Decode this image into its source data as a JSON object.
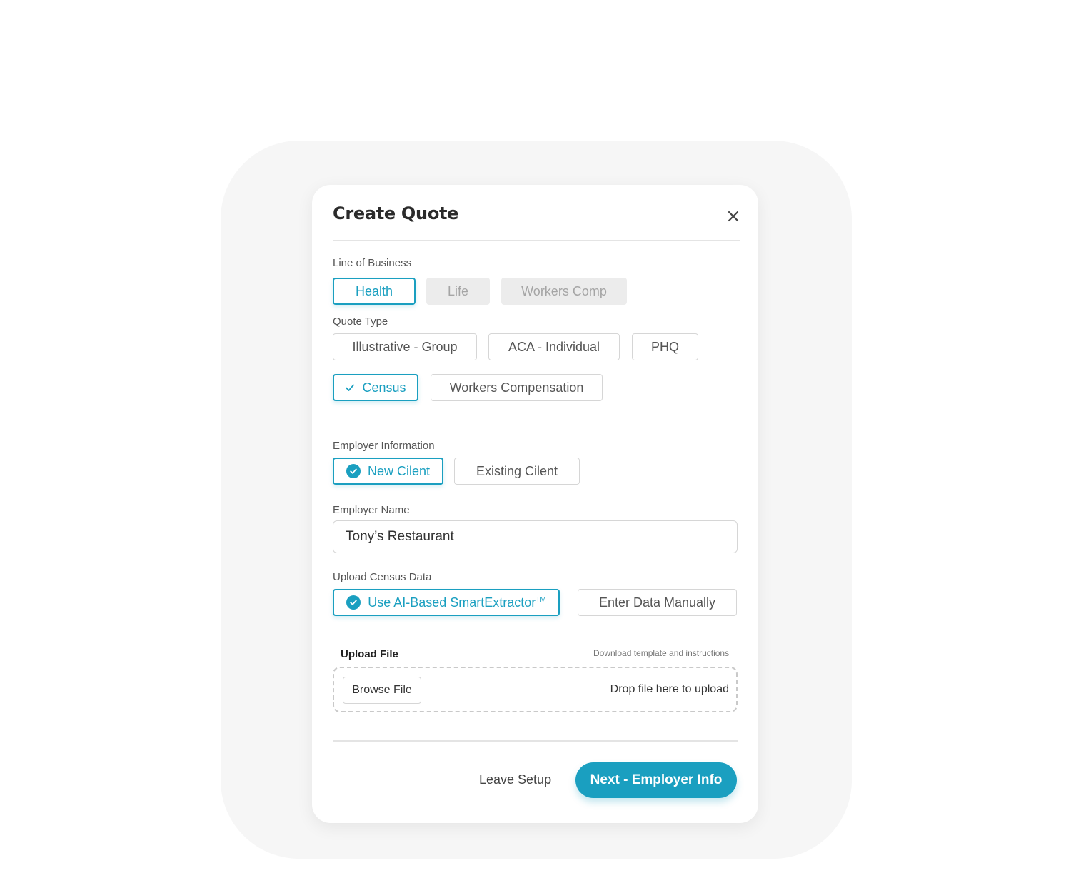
{
  "dialog": {
    "title": "Create Quote"
  },
  "line_of_business": {
    "label": "Line of Business",
    "options": [
      {
        "label": "Health",
        "state": "selected"
      },
      {
        "label": "Life",
        "state": "disabled"
      },
      {
        "label": "Workers Comp",
        "state": "disabled"
      }
    ]
  },
  "quote_type": {
    "label": "Quote Type",
    "options": [
      {
        "label": "Illustrative - Group",
        "state": "default"
      },
      {
        "label": "ACA - Individual",
        "state": "default"
      },
      {
        "label": "PHQ",
        "state": "default"
      },
      {
        "label": "Census",
        "state": "selected"
      },
      {
        "label": "Workers Compensation",
        "state": "default"
      }
    ]
  },
  "employer_information": {
    "label": "Employer Information",
    "options": [
      {
        "label": "New Cilent",
        "state": "selected"
      },
      {
        "label": "Existing Cilent",
        "state": "default"
      }
    ]
  },
  "employer_name": {
    "label": "Employer Name",
    "value": "Tony’s Restaurant"
  },
  "upload_census": {
    "label": "Upload Census Data",
    "options": [
      {
        "label": "Use AI-Based SmartExtractor",
        "superscript": "TM",
        "state": "selected"
      },
      {
        "label": "Enter Data Manually",
        "state": "default"
      }
    ]
  },
  "upload_file": {
    "title": "Upload File",
    "download_link": "Download template and instructions",
    "browse_label": "Browse File",
    "drop_text": "Drop file here to upload"
  },
  "footer": {
    "leave_label": "Leave Setup",
    "next_label": "Next - Employer Info"
  },
  "colors": {
    "accent": "#1a9fc0",
    "disabled_bg": "#ececec"
  }
}
